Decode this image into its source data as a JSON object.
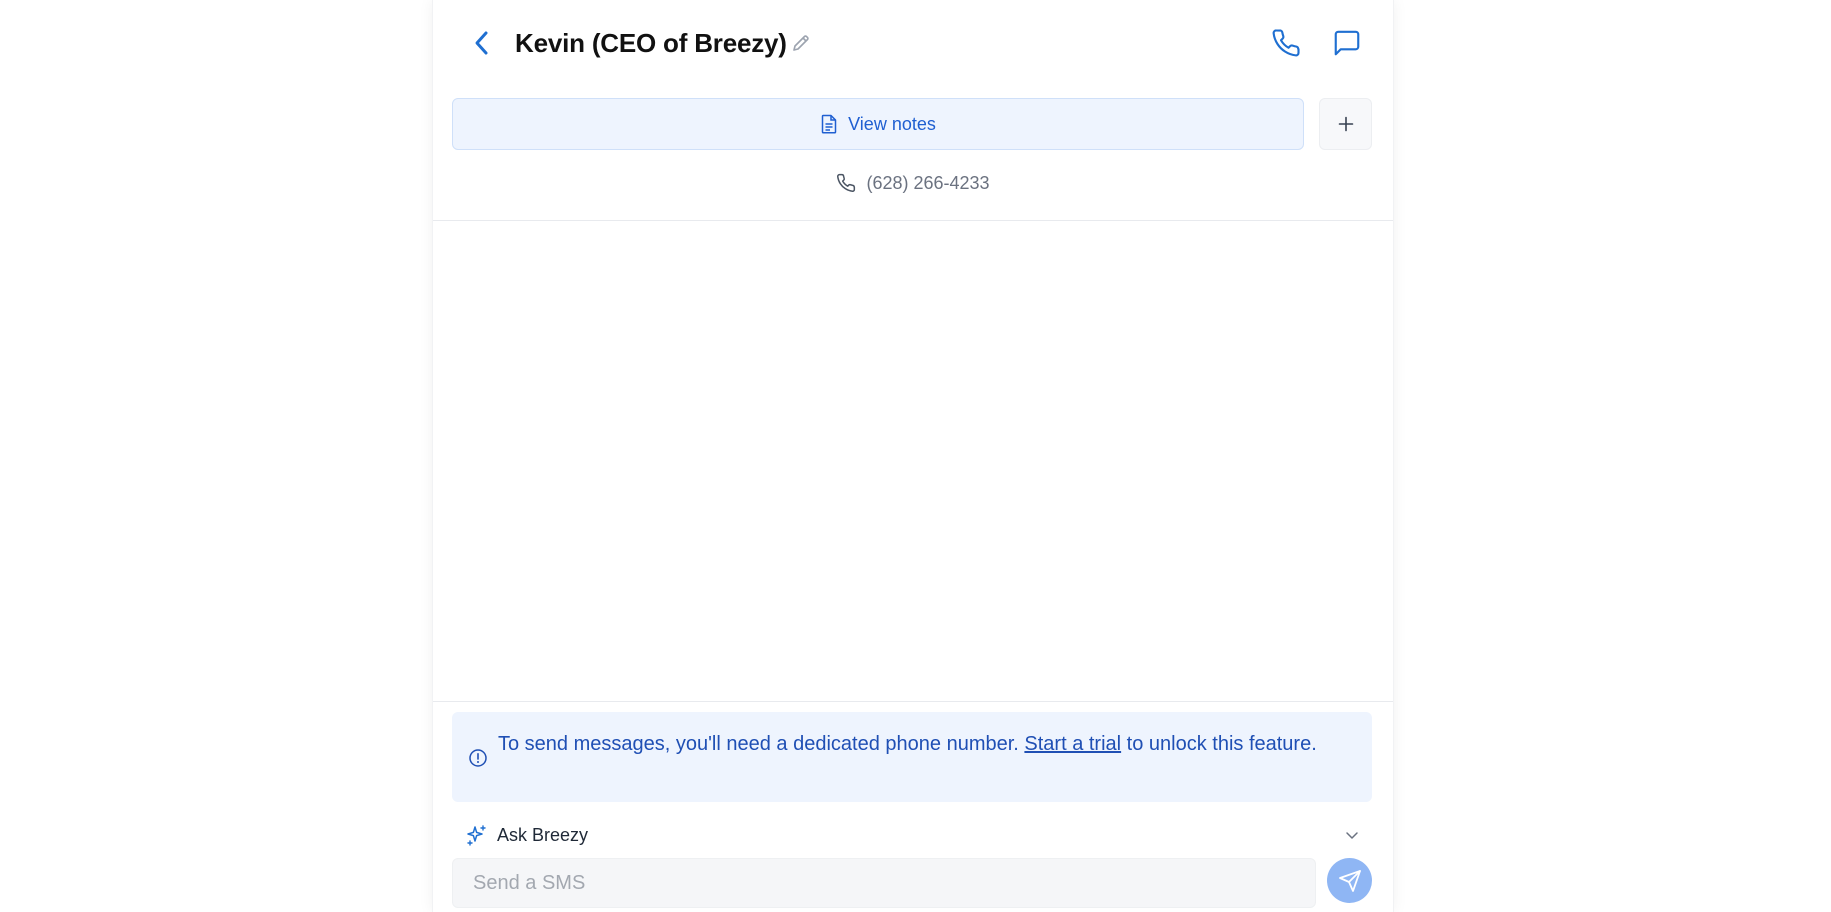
{
  "header": {
    "title": "Kevin (CEO of Breezy)"
  },
  "notes": {
    "view_label": "View notes"
  },
  "contact": {
    "phone": "(628) 266-4233"
  },
  "alert": {
    "text_before": "To send messages, you'll need a dedicated phone number. ",
    "link_label": "Start a trial",
    "text_after": " to unlock this feature."
  },
  "assistant": {
    "label": "Ask Breezy"
  },
  "composer": {
    "placeholder": "Send a SMS"
  },
  "icons": {
    "back": "chevron-left-icon",
    "edit": "pencil-icon",
    "call": "phone-icon",
    "message": "chat-bubble-icon",
    "notes": "document-icon",
    "add": "plus-icon",
    "contact_phone": "phone-icon",
    "alert": "info-circle-icon",
    "assistant": "sparkles-icon",
    "expand": "chevron-down-icon",
    "send": "paper-plane-icon"
  },
  "colors": {
    "accent": "#1f6fd1",
    "alert_bg": "#eef4fe",
    "send_button": "#8fb6f4"
  }
}
